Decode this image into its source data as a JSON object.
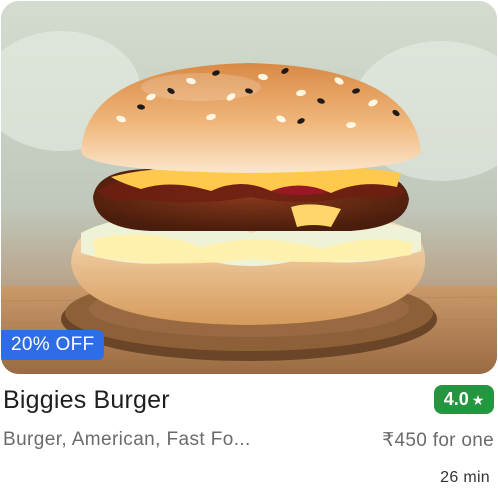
{
  "restaurant": {
    "image_alt": "Biggies Burger burger image",
    "offer": "20% OFF",
    "name": "Biggies Burger",
    "rating": "4.0",
    "rating_icon": "star-icon",
    "cuisines": "Burger, American, Fast Fo...",
    "price": "₹450 for one",
    "delivery_time": "26 min"
  },
  "colors": {
    "offer_badge": "#2e6de6",
    "rating_badge": "#24963f",
    "secondary_text": "#6b6b6b"
  }
}
